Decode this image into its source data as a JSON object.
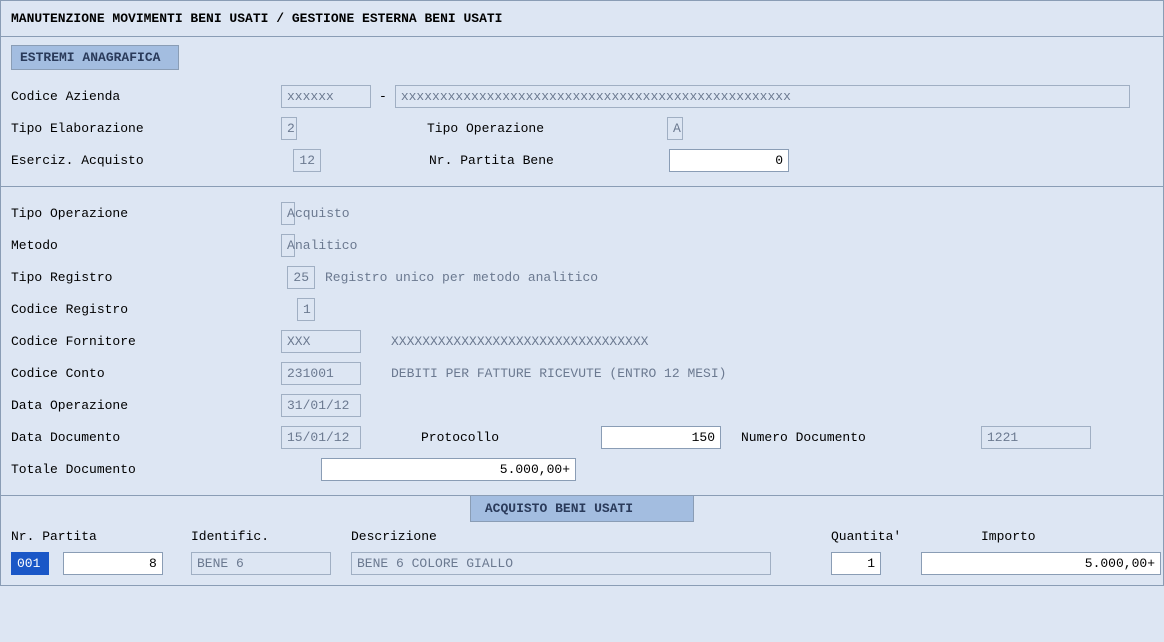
{
  "title": "MANUTENZIONE MOVIMENTI BENI USATI / GESTIONE ESTERNA BENI USATI",
  "section1": {
    "header": "ESTREMI ANAGRAFICA",
    "codice_azienda_label": "Codice Azienda",
    "codice_azienda_val": "xxxxxx",
    "codice_azienda_desc": "xxxxxxxxxxxxxxxxxxxxxxxxxxxxxxxxxxxxxxxxxxxxxxxxxx",
    "tipo_elab_label": "Tipo Elaborazione",
    "tipo_elab_val": "2",
    "tipo_oper_label": "Tipo Operazione",
    "tipo_oper_val": "A",
    "eserc_label": "Eserciz. Acquisto",
    "eserc_val": "12",
    "nr_partita_label": "Nr. Partita Bene",
    "nr_partita_val": "0"
  },
  "section2": {
    "tipo_oper_label": "Tipo Operazione",
    "tipo_oper_val": "A",
    "tipo_oper_desc": "cquisto",
    "metodo_label": "Metodo",
    "metodo_val": "A",
    "metodo_desc": "nalitico",
    "tipo_reg_label": "Tipo Registro",
    "tipo_reg_val": "25",
    "tipo_reg_desc": "Registro unico per metodo analitico",
    "cod_reg_label": "Codice Registro",
    "cod_reg_val": "1",
    "cod_forn_label": "Codice Fornitore",
    "cod_forn_val": "XXX",
    "cod_forn_desc": "XXXXXXXXXXXXXXXXXXXXXXXXXXXXXXXXX",
    "cod_conto_label": "Codice Conto",
    "cod_conto_val": "231001",
    "cod_conto_desc": "DEBITI PER FATTURE RICEVUTE (ENTRO 12 MESI)",
    "data_oper_label": "Data Operazione",
    "data_oper_val": "31/01/12",
    "data_doc_label": "Data Documento",
    "data_doc_val": "15/01/12",
    "protocollo_label": "Protocollo",
    "protocollo_val": "150",
    "num_doc_label": "Numero Documento",
    "num_doc_val": "1221",
    "totale_label": "Totale Documento",
    "totale_val": "5.000,00+"
  },
  "tab": {
    "label": "ACQUISTO BENI USATI"
  },
  "grid": {
    "h_nr": "Nr. Partita",
    "h_id": "Identific.",
    "h_desc": "Descrizione",
    "h_qty": "Quantita'",
    "h_imp": "Importo",
    "r1_nr_sel": "001",
    "r1_nr": "8",
    "r1_id": "BENE 6",
    "r1_desc": "BENE 6 COLORE GIALLO",
    "r1_qty": "1",
    "r1_imp": "5.000,00+"
  }
}
